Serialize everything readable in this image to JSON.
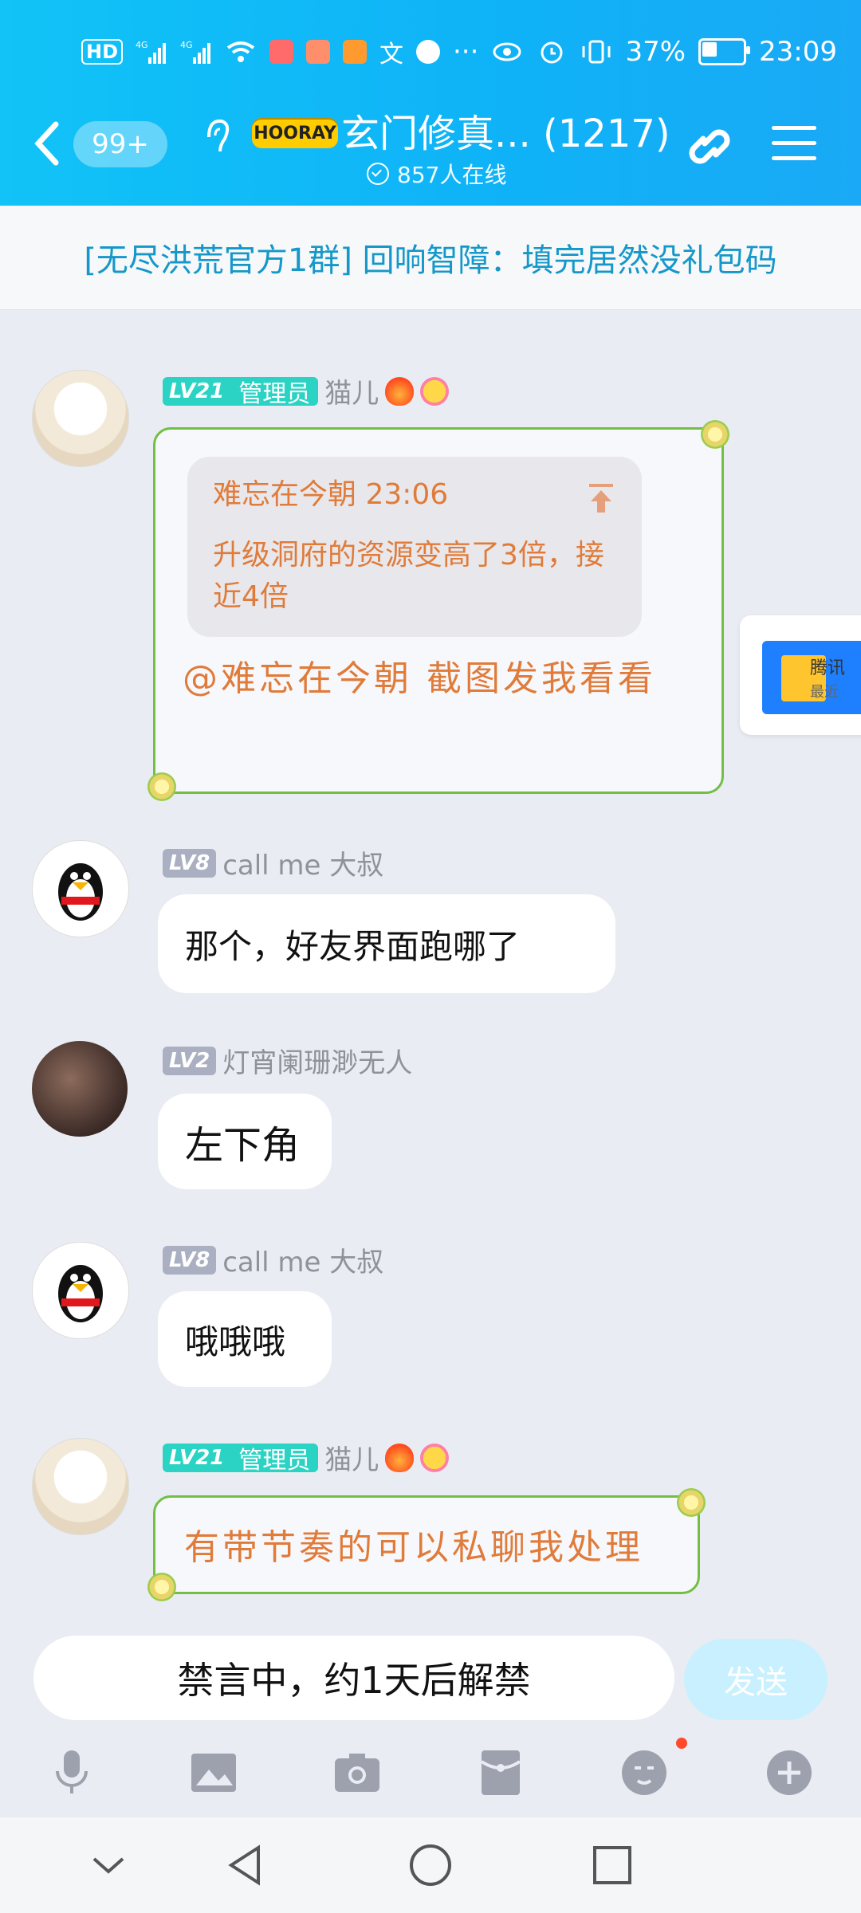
{
  "status_bar": {
    "left_icons": [
      "hd-icon",
      "signal-4g-icon",
      "signal-4g-icon",
      "wifi-icon",
      "app-icon-book",
      "app-icon-health",
      "app-icon-video",
      "app-icon-translate",
      "app-icon-browser"
    ],
    "more": "···",
    "battery_percent": "37%",
    "time": "23:09"
  },
  "header": {
    "badge_count": "99+",
    "group_title": "玄门修真... (1217)",
    "hooray_badge": "HOORAY",
    "online_count": "857人在线"
  },
  "announcement": "[无尽洪荒官方1群] 回响智障：填完居然没礼包码",
  "messages": [
    {
      "level": "LV21",
      "role": "管理员",
      "name": "猫儿",
      "quote": {
        "author_time": "难忘在今朝 23:06",
        "text": "升级洞府的资源变高了3倍，接近4倍"
      },
      "text": "@难忘在今朝 截图发我看看"
    },
    {
      "level": "LV8",
      "name": "call me 大叔",
      "text": "那个，好友界面跑哪了"
    },
    {
      "level": "LV2",
      "name": "灯宵阑珊渺无人",
      "text": "左下角"
    },
    {
      "level": "LV8",
      "name": "call me 大叔",
      "text": "哦哦哦"
    },
    {
      "level": "LV21",
      "role": "管理员",
      "name": "猫儿",
      "text": "有带节奏的可以私聊我处理"
    }
  ],
  "side_card": {
    "title": "腾讯",
    "subtitle": "最近"
  },
  "input": {
    "placeholder": "禁言中，约1天后解禁",
    "send_label": "发送"
  },
  "toolbar": [
    "mic-icon",
    "image-icon",
    "camera-icon",
    "redpacket-icon",
    "emoji-icon",
    "plus-icon"
  ],
  "colors": {
    "accent": "#11c3f7",
    "admin_tag": "#2ad3c3",
    "special_text": "#e07b3a",
    "border_green": "#72bf44"
  }
}
